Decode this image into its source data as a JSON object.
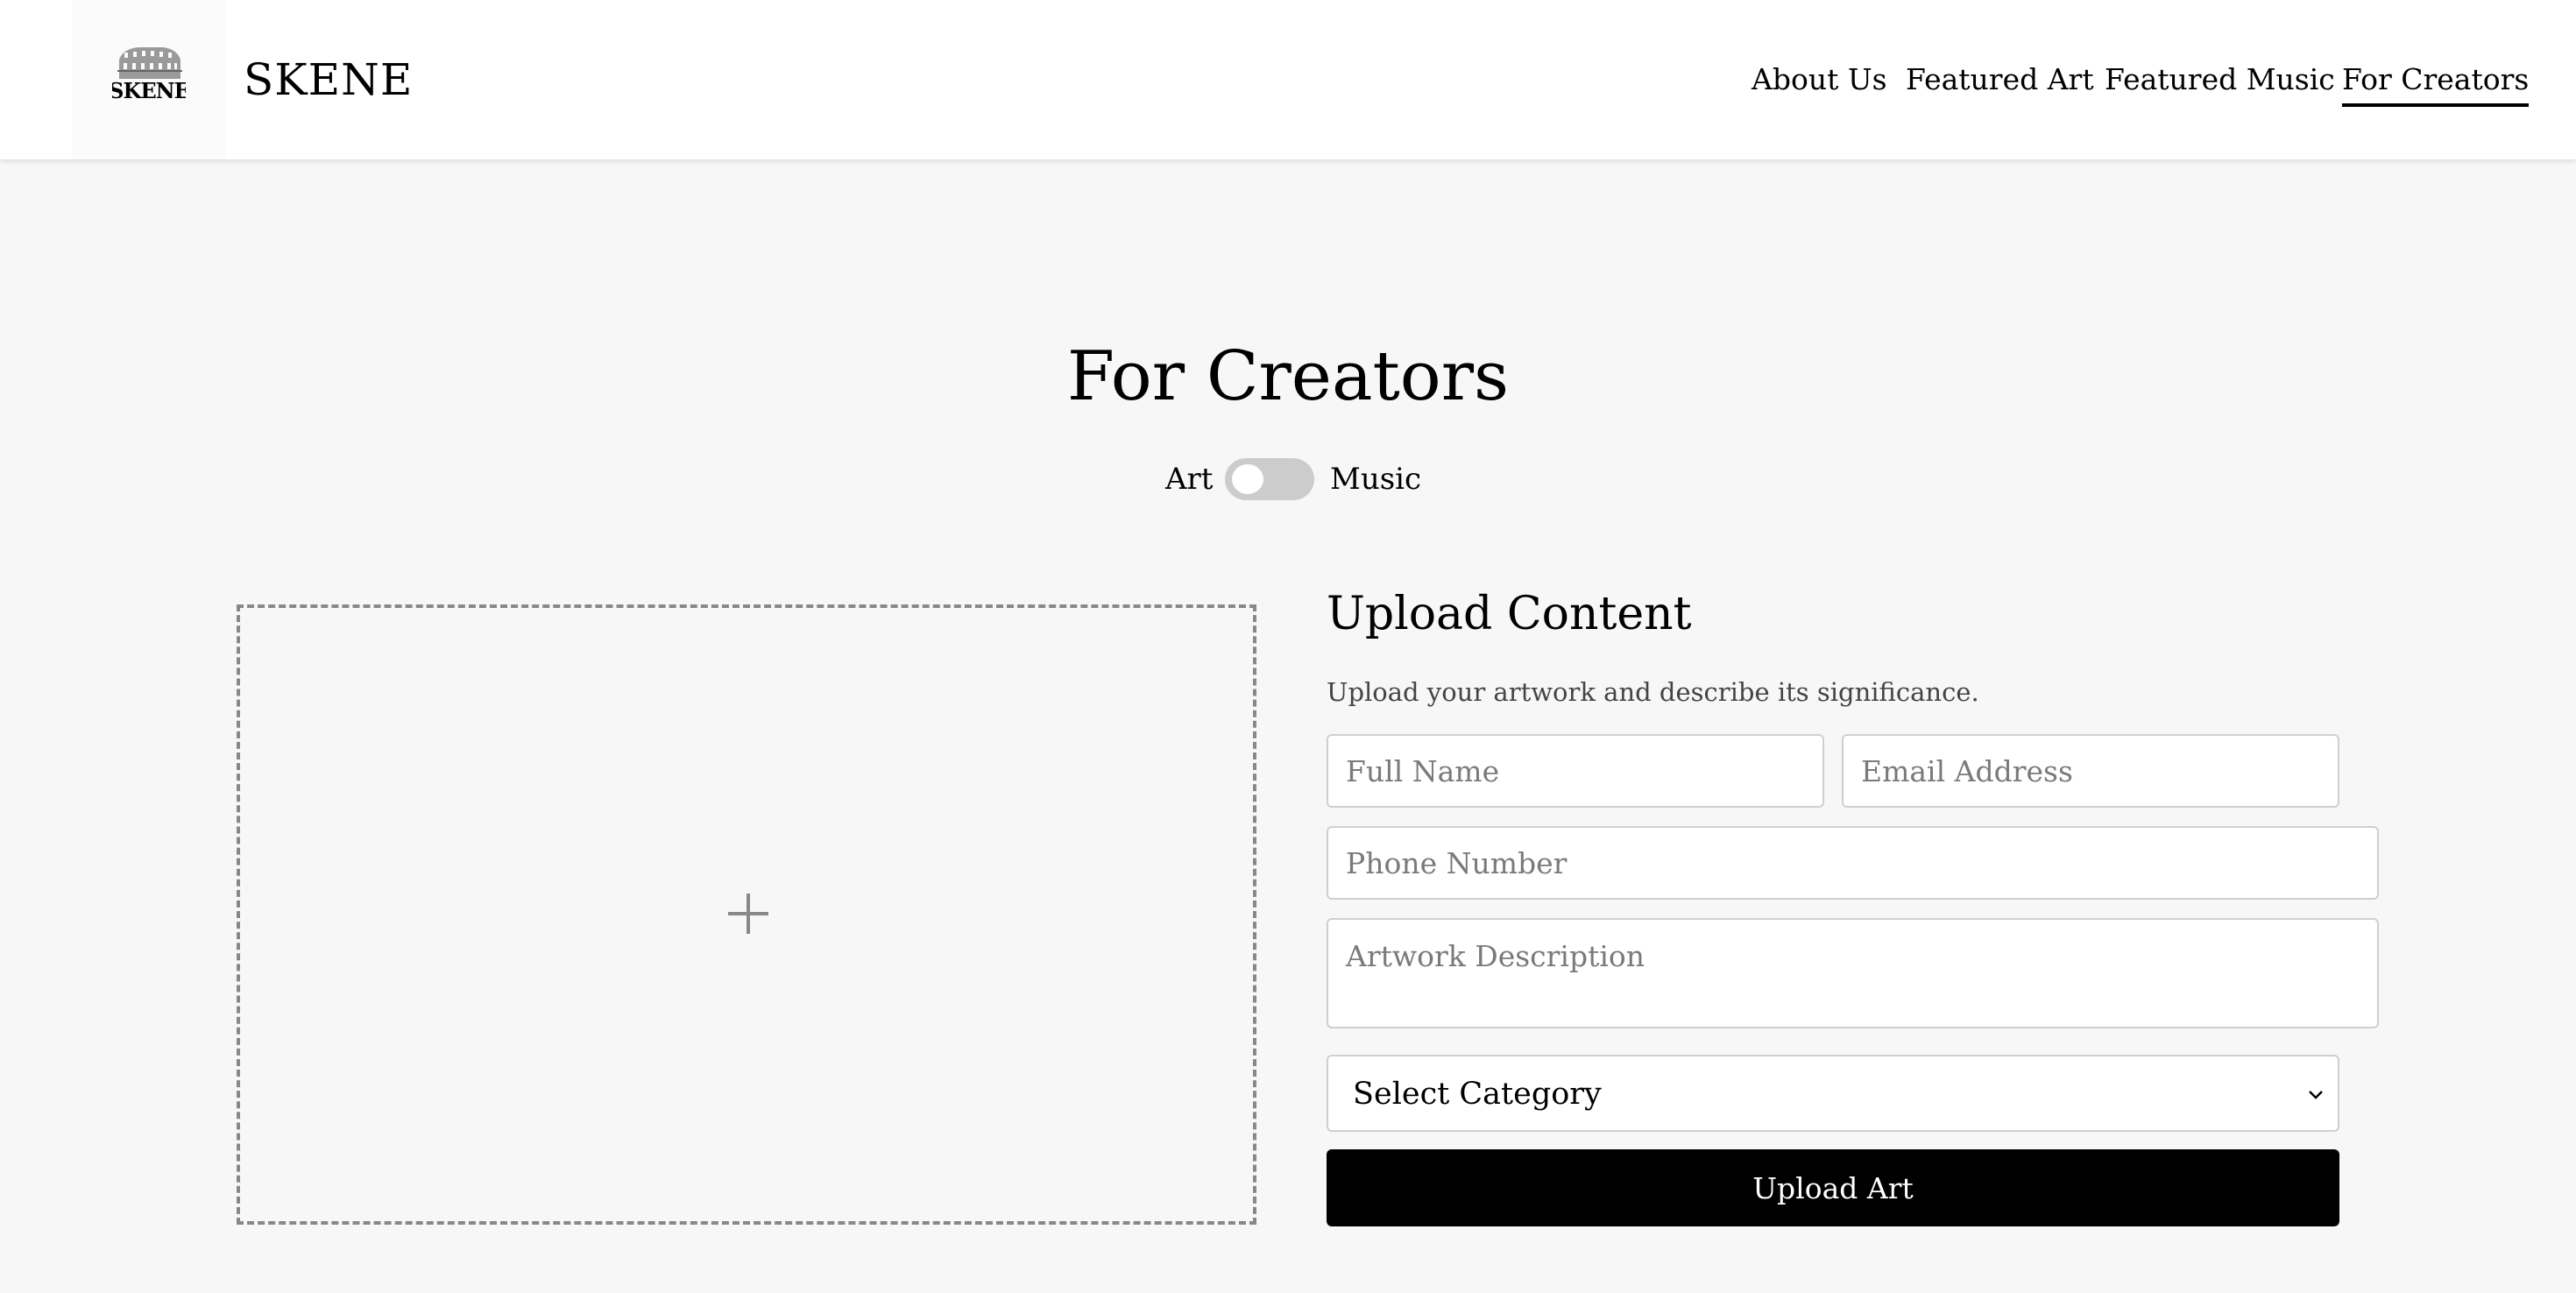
{
  "header": {
    "logo_text": "SKENE",
    "site_name": "SKENE",
    "nav": [
      {
        "label": "About Us",
        "active": false
      },
      {
        "label": "Featured Art",
        "active": false
      },
      {
        "label": "Featured Music",
        "active": false
      },
      {
        "label": "For Creators",
        "active": true
      }
    ]
  },
  "main": {
    "title": "For Creators",
    "toggle": {
      "left_label": "Art",
      "right_label": "Music",
      "state": "Art"
    }
  },
  "dropzone": {
    "icon": "plus-icon"
  },
  "form": {
    "title": "Upload Content",
    "description": "Upload your artwork and describe its significance.",
    "full_name_placeholder": "Full Name",
    "email_placeholder": "Email Address",
    "phone_placeholder": "Phone Number",
    "description_placeholder": "Artwork Description",
    "category_selected": "Select Category",
    "submit_label": "Upload Art"
  }
}
